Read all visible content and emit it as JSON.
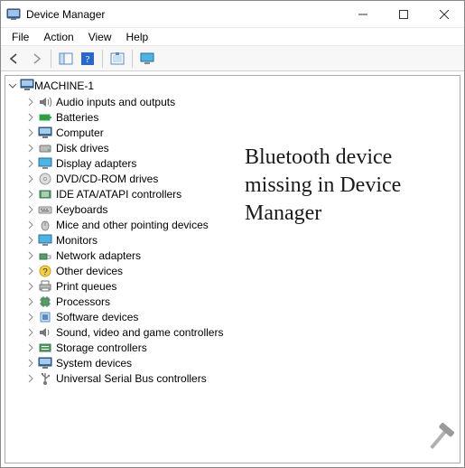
{
  "window": {
    "title": "Device Manager"
  },
  "menu": {
    "file": "File",
    "action": "Action",
    "view": "View",
    "help": "Help"
  },
  "tree": {
    "root": "MACHINE-1",
    "items": [
      "Audio inputs and outputs",
      "Batteries",
      "Computer",
      "Disk drives",
      "Display adapters",
      "DVD/CD-ROM drives",
      "IDE ATA/ATAPI controllers",
      "Keyboards",
      "Mice and other pointing devices",
      "Monitors",
      "Network adapters",
      "Other devices",
      "Print queues",
      "Processors",
      "Software devices",
      "Sound, video and game controllers",
      "Storage controllers",
      "System devices",
      "Universal Serial Bus controllers"
    ]
  },
  "annotation": {
    "text": "Bluetooth device missing in Device Manager"
  }
}
